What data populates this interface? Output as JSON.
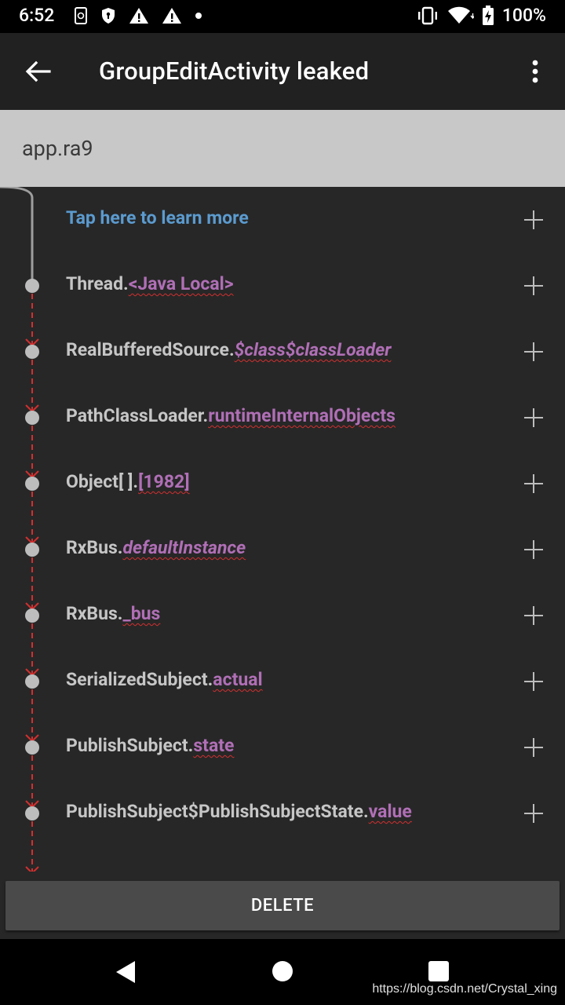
{
  "status_bar": {
    "time": "6:52",
    "battery": "100%"
  },
  "app_bar": {
    "title": "GroupEditActivity leaked"
  },
  "process": {
    "name": "app.ra9"
  },
  "trace": {
    "learn_more": "Tap here to learn more",
    "rows": [
      {
        "owner": "Thread.",
        "ref": "<Java Local>",
        "italic": false
      },
      {
        "owner": "RealBufferedSource.",
        "ref": "$class$classLoader",
        "italic": true
      },
      {
        "owner": "PathClassLoader.",
        "ref": "runtimeInternalObjects",
        "italic": false
      },
      {
        "owner": "Object[ ].",
        "ref": "[1982]",
        "italic": false
      },
      {
        "owner": "RxBus.",
        "ref": "defaultInstance",
        "italic": true
      },
      {
        "owner": "RxBus.",
        "ref": "_bus",
        "italic": false
      },
      {
        "owner": "SerializedSubject.",
        "ref": "actual",
        "italic": false
      },
      {
        "owner": "PublishSubject.",
        "ref": "state",
        "italic": false
      },
      {
        "owner": "PublishSubject$PublishSubjectState.",
        "ref": "value",
        "italic": false
      }
    ]
  },
  "actions": {
    "delete_label": "DELETE"
  },
  "watermark": "https://blog.csdn.net/Crystal_xing",
  "colors": {
    "background": "#272727",
    "app_bar": "#212121",
    "header": "#c8c8c8",
    "link": "#5b9bcf",
    "reference": "#b06fb6",
    "leak_line": "#d32f2f"
  }
}
